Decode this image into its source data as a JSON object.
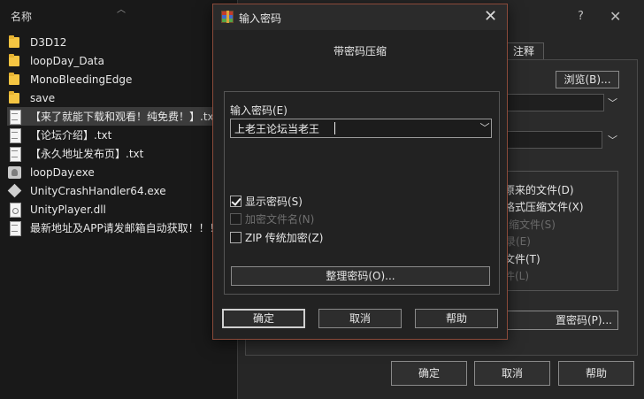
{
  "explorer": {
    "column_name": "名称",
    "files": [
      {
        "name": "D3D12",
        "icon": "folder-icon"
      },
      {
        "name": "loopDay_Data",
        "icon": "folder-icon"
      },
      {
        "name": "MonoBleedingEdge",
        "icon": "folder-icon"
      },
      {
        "name": "save",
        "icon": "folder-icon"
      },
      {
        "name": "【来了就能下载和观看！纯免费！】.txt",
        "icon": "text-file-icon",
        "selected": true
      },
      {
        "name": "【论坛介绍】.txt",
        "icon": "text-file-icon"
      },
      {
        "name": "【永久地址发布页】.txt",
        "icon": "text-file-icon"
      },
      {
        "name": "loopDay.exe",
        "icon": "exe-icon"
      },
      {
        "name": "UnityCrashHandler64.exe",
        "icon": "unity-cube-icon"
      },
      {
        "name": "UnityPlayer.dll",
        "icon": "dll-file-icon"
      },
      {
        "name": "最新地址及APP请发邮箱自动获取！！！",
        "icon": "text-file-icon"
      }
    ]
  },
  "bg_dialog": {
    "help": "?",
    "close": "✕",
    "tab_comment": "注释",
    "browse": "浏览(B)...",
    "options": [
      {
        "label": "原来的文件(D)",
        "enabled": true
      },
      {
        "label": "格式压缩文件(X)",
        "enabled": true
      },
      {
        "label": "缩文件(S)",
        "enabled": false
      },
      {
        "label": "录(E)",
        "enabled": false
      },
      {
        "label": "文件(T)",
        "enabled": true
      },
      {
        "label": "件(L)",
        "enabled": false
      }
    ],
    "set_password": "置密码(P)...",
    "ok": "确定",
    "cancel": "取消",
    "help_btn": "帮助"
  },
  "pw_dialog": {
    "title": "输入密码",
    "heading": "带密码压缩",
    "input_label": "输入密码(E)",
    "password_value": "上老王论坛当老王",
    "show_password": "显示密码(S)",
    "encrypt_names": "加密文件名(N)",
    "zip_legacy": "ZIP 传统加密(Z)",
    "organize": "整理密码(O)...",
    "ok": "确定",
    "cancel": "取消",
    "help": "帮助",
    "show_password_checked": true,
    "encrypt_names_checked": false,
    "zip_legacy_checked": false
  }
}
